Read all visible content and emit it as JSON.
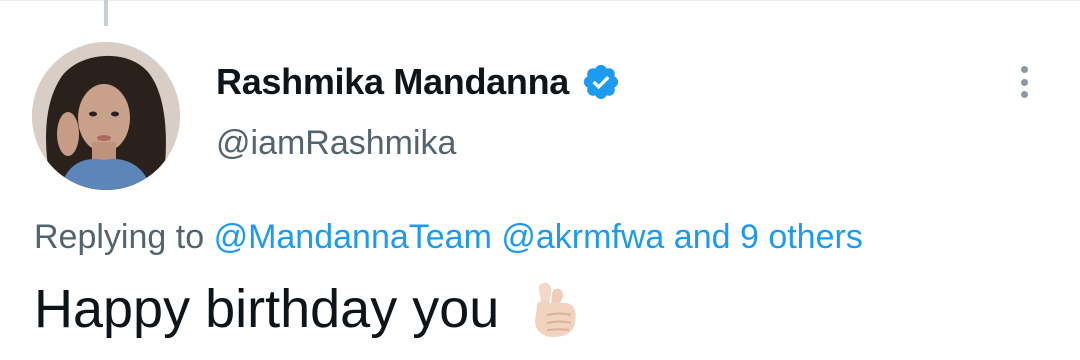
{
  "tweet": {
    "author": {
      "display_name": "Rashmika Mandanna",
      "handle": "@iamRashmika",
      "verified": true,
      "avatar_icon": "avatar-photo"
    },
    "menu_icon": "more-vertical-icon",
    "reply_context": {
      "prefix": "Replying to",
      "mention_1": "@MandannaTeam",
      "mention_2": "@akrmfwa",
      "others": "and 9 others"
    },
    "text": "Happy birthday you",
    "emoji_icon": "finger-heart-emoji-icon"
  },
  "colors": {
    "accent": "#1d9bf0",
    "text_primary": "#0f1419",
    "text_secondary": "#536471"
  }
}
